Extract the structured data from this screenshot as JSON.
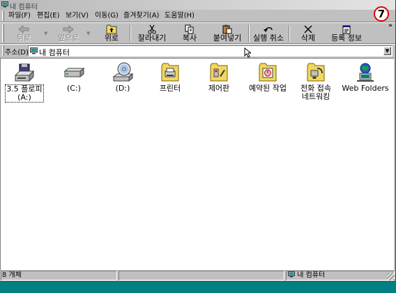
{
  "window": {
    "title": "내 컴퓨터",
    "step_badge": "7"
  },
  "menu": {
    "items": [
      "파일(F)",
      "편집(E)",
      "보기(V)",
      "이동(G)",
      "즐겨찾기(A)",
      "도움말(H)"
    ]
  },
  "toolbar": {
    "back": "뒤로",
    "forward": "앞으로",
    "up": "위로",
    "cut": "잘라내기",
    "copy": "복사",
    "paste": "붙여넣기",
    "undo": "실행 취소",
    "delete": "삭제",
    "properties": "등록 정보",
    "more": "»"
  },
  "address": {
    "label": "주소(D)",
    "value": "내 컴퓨터"
  },
  "items": [
    {
      "label": "3.5 플로피\n(A:)",
      "icon": "floppy-drive-icon",
      "selected": true
    },
    {
      "label": "(C:)",
      "icon": "hard-drive-icon"
    },
    {
      "label": "(D:)",
      "icon": "cd-drive-icon"
    },
    {
      "label": "프린터",
      "icon": "printers-folder-icon"
    },
    {
      "label": "제어판",
      "icon": "control-panel-icon"
    },
    {
      "label": "예약된 작업",
      "icon": "scheduled-tasks-icon"
    },
    {
      "label": "전화 접속\n네트워킹",
      "icon": "dial-up-networking-icon"
    },
    {
      "label": "Web Folders",
      "icon": "web-folders-icon"
    }
  ],
  "status": {
    "count": "8 개체",
    "location": "내 컴퓨터"
  },
  "colors": {
    "desktop": "#008080",
    "face": "#c0c0c0",
    "folder": "#f0d860",
    "badge_ring": "#e00000"
  }
}
